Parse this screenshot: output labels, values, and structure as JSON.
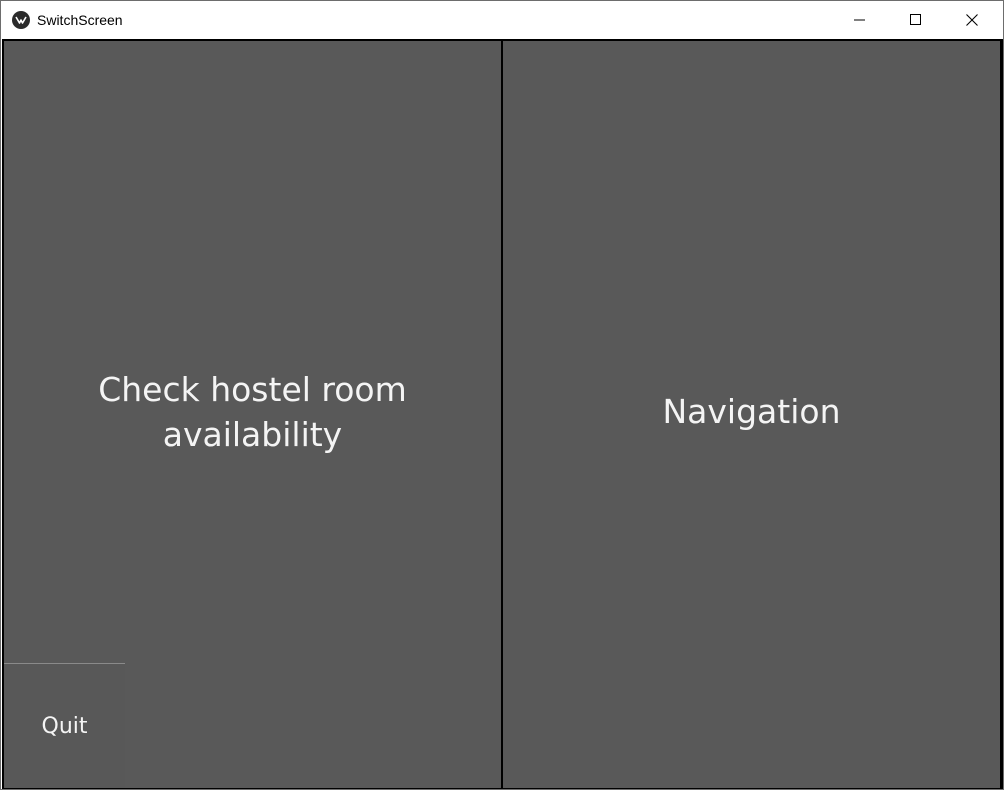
{
  "window": {
    "title": "SwitchScreen",
    "app_icon": "kivy-icon"
  },
  "window_controls": {
    "minimize_icon": "minimize-icon",
    "maximize_icon": "maximize-icon",
    "close_icon": "close-icon"
  },
  "main": {
    "left_button_label": "Check hostel room\navailability",
    "right_button_label": "Navigation",
    "quit_label": "Quit"
  },
  "colors": {
    "panel_background": "#595959",
    "label_text": "#f4f4f4",
    "divider": "#000000"
  }
}
